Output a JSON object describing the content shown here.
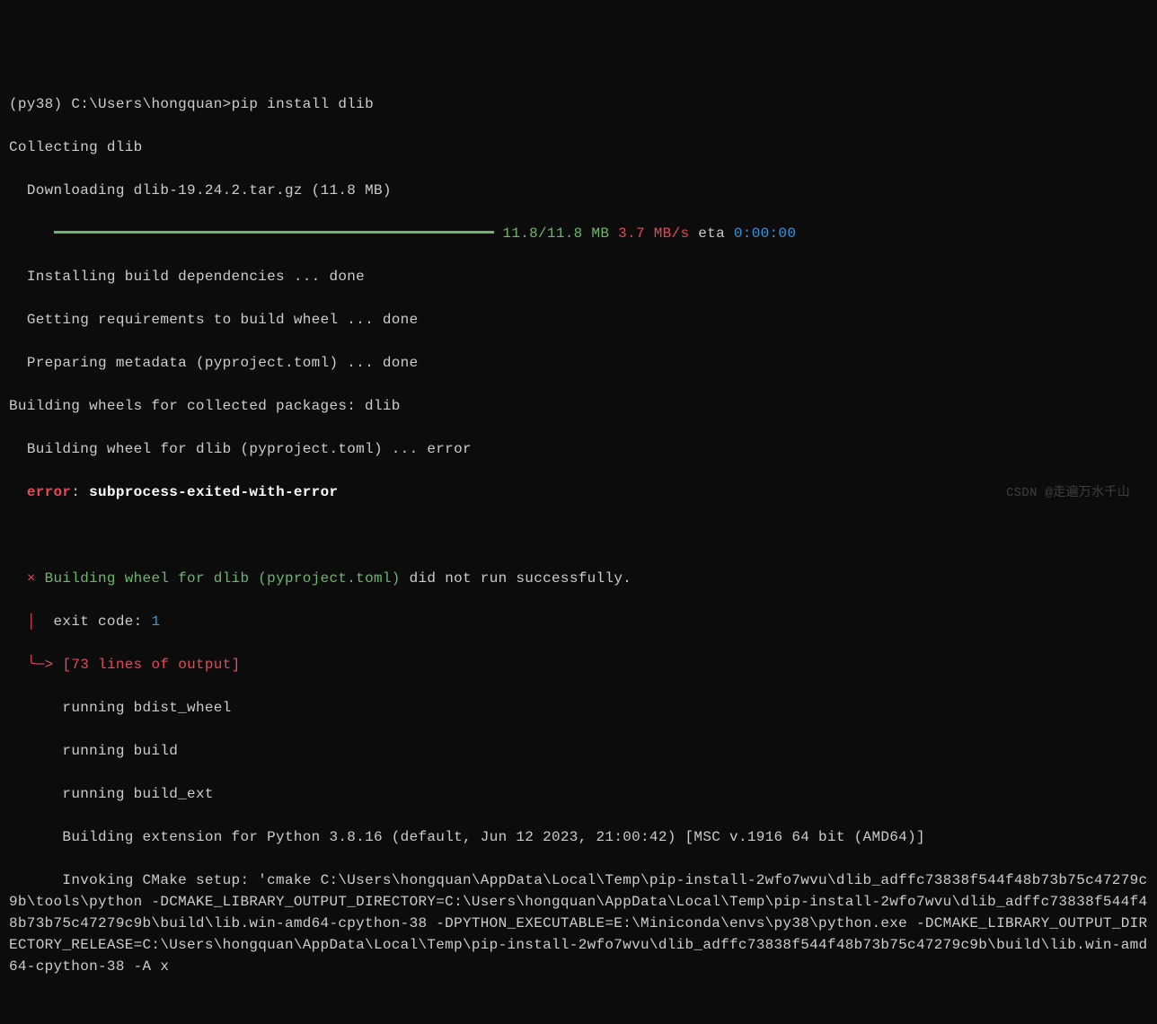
{
  "prompt": {
    "env": "(py38)",
    "path": "C:\\Users\\hongquan>",
    "command": "pip install dlib"
  },
  "collecting": "Collecting dlib",
  "downloading": "  Downloading dlib-19.24.2.tar.gz (11.8 MB)",
  "progress": {
    "indent": "     ",
    "size": "11.8/11.8 MB",
    "speed": "3.7 MB/s",
    "eta_label": "eta",
    "eta": "0:00:00"
  },
  "build_steps": [
    "  Installing build dependencies ... done",
    "  Getting requirements to build wheel ... done",
    "  Preparing metadata (pyproject.toml) ... done",
    "Building wheels for collected packages: dlib",
    "  Building wheel for dlib (pyproject.toml) ... error"
  ],
  "error_top": {
    "label": "error",
    "colon": ": ",
    "message": "subprocess-exited-with-error"
  },
  "error_block": {
    "indent": "  ",
    "cross": "×",
    "building_wheel": "Building wheel for dlib (pyproject.toml)",
    "did_not_run": " did not run successfully.",
    "pipe": "│",
    "exit_code_label": "  exit code: ",
    "exit_code": "1",
    "arrow": "╰─>",
    "output_label": "[73 lines of output]"
  },
  "output_lines": [
    "      running bdist_wheel",
    "      running build",
    "      running build_ext",
    "      Building extension for Python 3.8.16 (default, Jun 12 2023, 21:00:42) [MSC v.1916 64 bit (AMD64)]"
  ],
  "cmake_line": "      Invoking CMake setup: 'cmake C:\\Users\\hongquan\\AppData\\Local\\Temp\\pip-install-2wfo7wvu\\dlib_adffc73838f544f48b73b75c47279c9b\\tools\\python -DCMAKE_LIBRARY_OUTPUT_DIRECTORY=C:\\Users\\hongquan\\AppData\\Local\\Temp\\pip-install-2wfo7wvu\\dlib_adffc73838f544f48b73b75c47279c9b\\build\\lib.win-amd64-cpython-38 -DPYTHON_EXECUTABLE=E:\\Miniconda\\envs\\py38\\python.exe -DCMAKE_LIBRARY_OUTPUT_DIRECTORY_RELEASE=C:\\Users\\hongquan\\AppData\\Local\\Temp\\pip-install-2wfo7wvu\\dlib_adffc73838f544f48b73b75c47279c9b\\build\\lib.win-amd64-cpython-38 -A x",
  "watermark": "CSDN @走遍万水千山"
}
